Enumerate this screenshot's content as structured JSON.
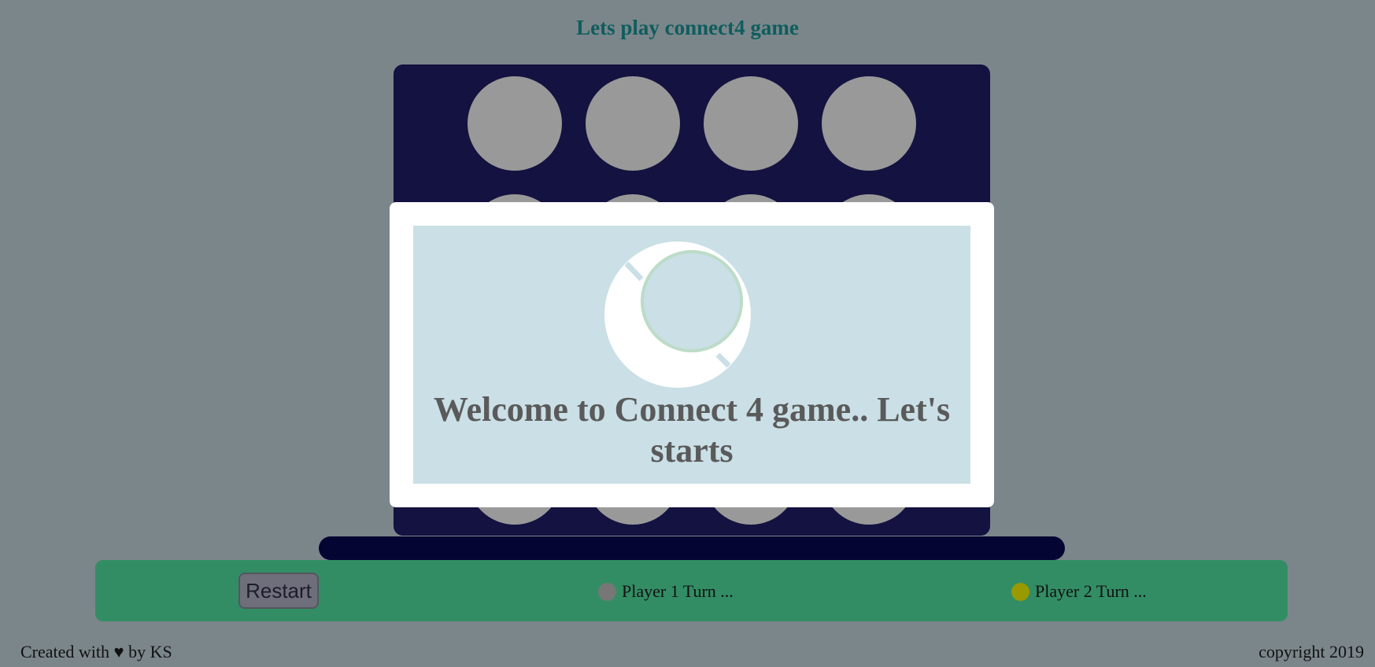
{
  "header": {
    "title": "Lets play connect4 game"
  },
  "board": {
    "columns": 4,
    "rows": 4,
    "cells": [
      "empty",
      "empty",
      "empty",
      "empty",
      "empty",
      "empty",
      "empty",
      "empty",
      "empty",
      "empty",
      "empty",
      "empty",
      "empty",
      "empty",
      "empty",
      "empty"
    ],
    "empty_color": "#999999",
    "board_color": "#131240"
  },
  "modal": {
    "message": "Welcome to Connect 4 game.. Let's starts",
    "loader_icon": "spinner-icon"
  },
  "controls": {
    "restart_label": "Restart",
    "player1": {
      "label": "Player 1 Turn ...",
      "color": "#777777"
    },
    "player2": {
      "label": "Player 2 Turn ...",
      "color": "#999900"
    }
  },
  "footer": {
    "left_prefix": "Created with",
    "heart_icon": "♥",
    "left_suffix": "by KS",
    "right": "copyright 2019"
  }
}
